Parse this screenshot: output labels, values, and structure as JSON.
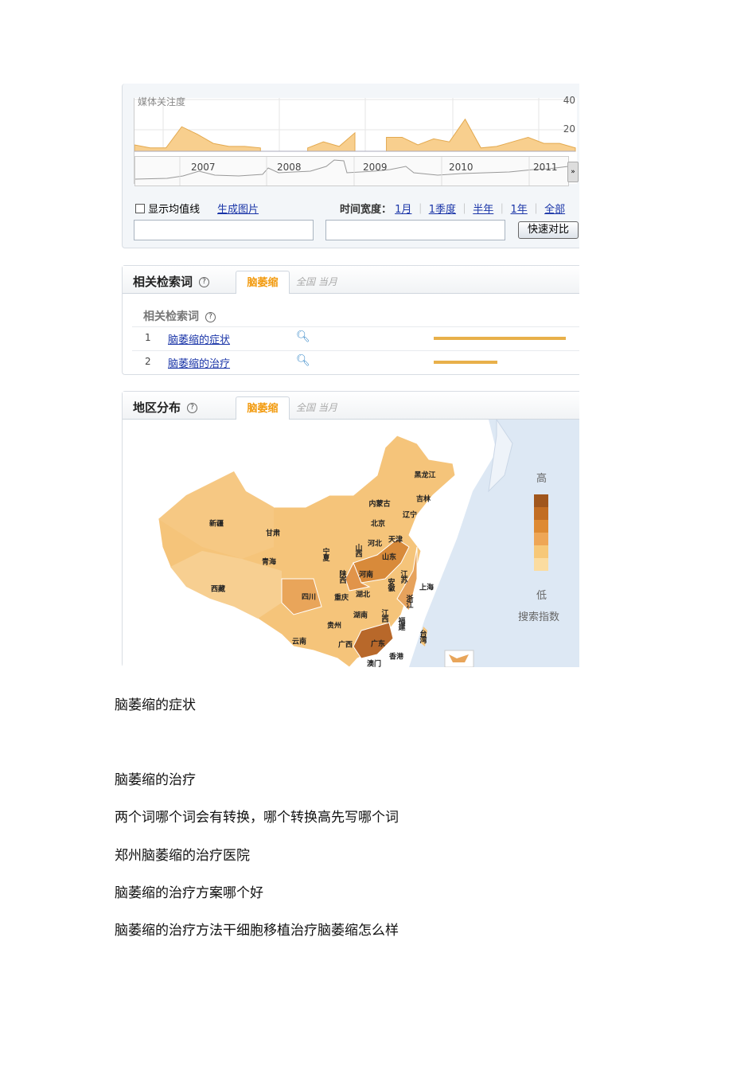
{
  "trend": {
    "media_label": "媒体关注度",
    "y_ticks": [
      "40",
      "20"
    ],
    "years": [
      "2007",
      "2008",
      "2009",
      "2010",
      "2011"
    ],
    "show_avg": "显示均值线",
    "gen_image": "生成图片",
    "time_width_label": "时间宽度：",
    "time_options": [
      "1月",
      "1季度",
      "半年",
      "1年",
      "全部"
    ],
    "compare_button": "快速对比",
    "input1": "",
    "input2": ""
  },
  "chart_data": {
    "type": "area",
    "title": "媒体关注度",
    "ylim": [
      0,
      40
    ],
    "yticks": [
      20,
      40
    ],
    "xlabels": [
      "2007",
      "2008",
      "2009",
      "2010",
      "2011"
    ],
    "values": [
      10,
      8,
      8,
      22,
      17,
      11,
      9,
      9,
      8,
      null,
      null,
      8,
      12,
      9,
      18,
      null,
      15,
      15,
      10,
      14,
      12,
      27,
      8,
      9,
      12,
      15,
      11,
      11,
      8
    ],
    "color": "#f8cf8e"
  },
  "related": {
    "title": "相关检索词",
    "help": "?",
    "tab": "脑萎缩",
    "scope": "全国 当月",
    "sub_title": "相关检索词",
    "rows": [
      {
        "rank": "1",
        "term": "脑萎缩的症状",
        "value": 1.0
      },
      {
        "rank": "2",
        "term": "脑萎缩的治疗",
        "value": 0.48
      }
    ]
  },
  "region": {
    "title": "地区分布",
    "help": "?",
    "tab": "脑萎缩",
    "scope": "全国 当月",
    "legend_high": "高",
    "legend_low": "低",
    "legend_title": "搜索指数",
    "legend_colors": [
      "#a0561c",
      "#c26d22",
      "#de8a33",
      "#eea656",
      "#f7c878",
      "#fbdca0"
    ],
    "provinces": [
      "黑龙江",
      "吉林",
      "辽宁",
      "内蒙古",
      "北京",
      "天津",
      "河北",
      "山东",
      "山西",
      "新疆",
      "甘肃",
      "宁夏",
      "青海",
      "陕西",
      "河南",
      "江苏",
      "安徽",
      "上海",
      "西藏",
      "四川",
      "重庆",
      "湖北",
      "浙江",
      "湖南",
      "江西",
      "贵州",
      "福建",
      "云南",
      "广西",
      "广东",
      "台湾",
      "香港",
      "澳门"
    ]
  },
  "doc": [
    "脑萎缩的症状",
    "脑萎缩的治疗",
    "两个词哪个词会有转换，哪个转换高先写哪个词",
    "郑州脑萎缩的治疗医院",
    "脑萎缩的治疗方案哪个好",
    "脑萎缩的治疗方法干细胞移植治疗脑萎缩怎么样"
  ]
}
